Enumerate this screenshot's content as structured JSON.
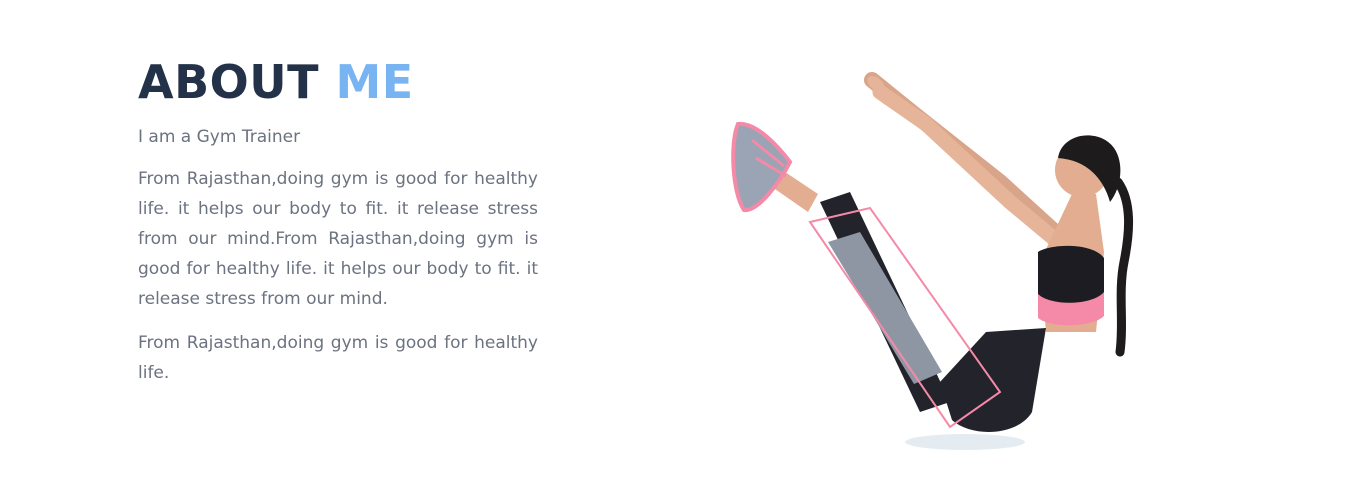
{
  "about": {
    "heading_main": "ABOUT",
    "heading_accent": "ME",
    "subtitle": "I am a Gym Trainer",
    "paragraph_1": "From Rajasthan,doing gym is good for healthy life. it helps our body to fit. it release stress from our mind.From Rajasthan,doing gym is good for healthy life. it helps our body to fit. it release stress from our mind.",
    "paragraph_2": "From Rajasthan,doing gym is good for healthy life."
  },
  "image": {
    "subject": "woman-doing-boat-pose"
  },
  "colors": {
    "heading_dark": "#243249",
    "heading_accent": "#79b4f2",
    "body_text": "#6b7280",
    "accent_pink": "#f48aa8",
    "legging_grey": "#8e96a4"
  }
}
